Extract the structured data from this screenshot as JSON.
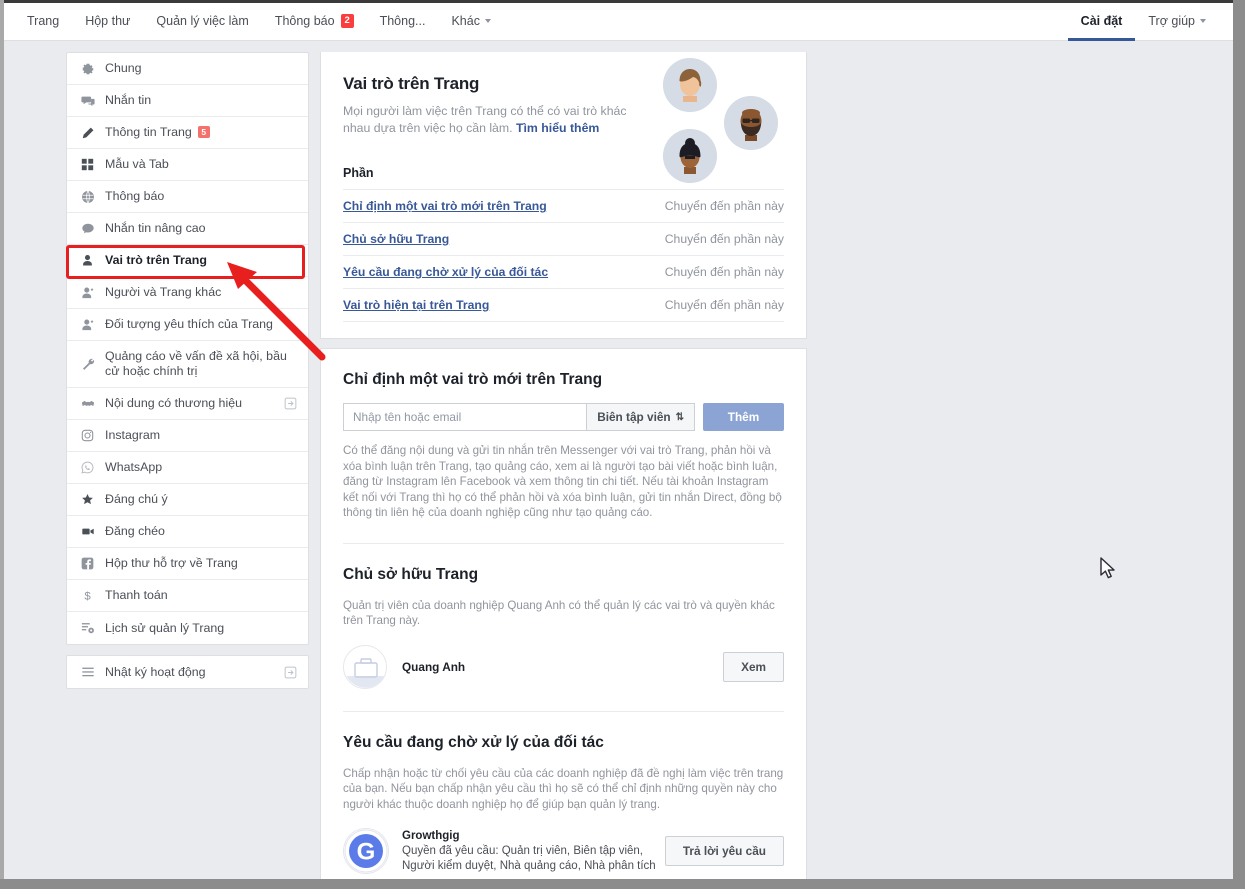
{
  "topnav": {
    "left_items": [
      {
        "label": "Trang",
        "badge": null,
        "caret": false
      },
      {
        "label": "Hộp thư",
        "badge": null,
        "caret": false
      },
      {
        "label": "Quản lý việc làm",
        "badge": null,
        "caret": false
      },
      {
        "label": "Thông báo",
        "badge": "2",
        "caret": false
      },
      {
        "label": "Thông...",
        "badge": null,
        "caret": false
      },
      {
        "label": "Khác",
        "badge": null,
        "caret": true
      }
    ],
    "right_items": [
      {
        "label": "Cài đặt",
        "active": true,
        "caret": false
      },
      {
        "label": "Trợ giúp",
        "active": false,
        "caret": true
      }
    ]
  },
  "sidebar": {
    "group1": [
      {
        "label": "Chung",
        "icon": "gear-icon",
        "badge": null,
        "external": false,
        "selected": false
      },
      {
        "label": "Nhắn tin",
        "icon": "messaging-icon",
        "badge": null,
        "external": false,
        "selected": false
      },
      {
        "label": "Thông tin Trang",
        "icon": "pencil-icon",
        "badge": "5",
        "external": false,
        "selected": false
      },
      {
        "label": "Mẫu và Tab",
        "icon": "grid-icon",
        "badge": null,
        "external": false,
        "selected": false
      },
      {
        "label": "Thông báo",
        "icon": "globe-icon",
        "badge": null,
        "external": false,
        "selected": false
      },
      {
        "label": "Nhắn tin nâng cao",
        "icon": "chat-bubble-icon",
        "badge": null,
        "external": false,
        "selected": false
      },
      {
        "label": "Vai trò trên Trang",
        "icon": "person-icon",
        "badge": null,
        "external": false,
        "selected": true
      },
      {
        "label": "Người và Trang khác",
        "icon": "person-star-icon",
        "badge": null,
        "external": false,
        "selected": false
      },
      {
        "label": "Đối tượng yêu thích của Trang",
        "icon": "person-star-icon",
        "badge": null,
        "external": false,
        "selected": false
      },
      {
        "label": "Quảng cáo về vấn đề xã hội, bầu cử hoặc chính trị",
        "icon": "wrench-icon",
        "badge": null,
        "external": false,
        "selected": false
      },
      {
        "label": "Nội dung có thương hiệu",
        "icon": "handshake-icon",
        "badge": null,
        "external": true,
        "selected": false
      },
      {
        "label": "Instagram",
        "icon": "instagram-icon",
        "badge": null,
        "external": false,
        "selected": false
      },
      {
        "label": "WhatsApp",
        "icon": "whatsapp-icon",
        "badge": null,
        "external": false,
        "selected": false
      },
      {
        "label": "Đáng chú ý",
        "icon": "star-icon",
        "badge": null,
        "external": false,
        "selected": false
      },
      {
        "label": "Đăng chéo",
        "icon": "video-icon",
        "badge": null,
        "external": false,
        "selected": false
      },
      {
        "label": "Hộp thư hỗ trợ về Trang",
        "icon": "facebook-icon",
        "badge": null,
        "external": false,
        "selected": false
      },
      {
        "label": "Thanh toán",
        "icon": "dollar-icon",
        "badge": null,
        "external": false,
        "selected": false
      },
      {
        "label": "Lịch sử quản lý Trang",
        "icon": "history-icon",
        "badge": null,
        "external": false,
        "selected": false
      }
    ],
    "group2": [
      {
        "label": "Nhật ký hoạt động",
        "icon": "list-icon",
        "badge": null,
        "external": true,
        "selected": false
      }
    ]
  },
  "hero": {
    "title": "Vai trò trên Trang",
    "description": "Mọi người làm việc trên Trang có thể có vai trò khác nhau dựa trên việc họ cần làm.",
    "learn_more": "Tìm hiểu thêm",
    "sections_label": "Phần",
    "jump_rows": [
      {
        "name": "Chỉ định một vai trò mới trên Trang",
        "action": "Chuyển đến phần này"
      },
      {
        "name": "Chủ sở hữu Trang",
        "action": "Chuyển đến phần này"
      },
      {
        "name": "Yêu cầu đang chờ xử lý của đối tác",
        "action": "Chuyển đến phần này"
      },
      {
        "name": "Vai trò hiện tại trên Trang",
        "action": "Chuyển đến phần này"
      }
    ]
  },
  "assign": {
    "title": "Chỉ định một vai trò mới trên Trang",
    "input_placeholder": "Nhập tên hoặc email",
    "input_value": "",
    "role_selected": "Biên tập viên",
    "add_label": "Thêm",
    "description": "Có thể đăng nội dung và gửi tin nhắn trên Messenger với vai trò Trang, phản hồi và xóa bình luận trên Trang, tạo quảng cáo, xem ai là người tạo bài viết hoặc bình luận, đăng từ Instagram lên Facebook và xem thông tin chi tiết. Nếu tài khoản Instagram kết nối với Trang thì họ có thể phản hồi và xóa bình luận, gửi tin nhắn Direct, đồng bộ thông tin liên hệ của doanh nghiệp cũng như tạo quảng cáo."
  },
  "owner": {
    "title": "Chủ sở hữu Trang",
    "description": "Quản trị viên của doanh nghiệp Quang Anh có thể quản lý các vai trò và quyền khác trên Trang này.",
    "owner_name": "Quang Anh",
    "view_label": "Xem"
  },
  "pending": {
    "title": "Yêu cầu đang chờ xử lý của đối tác",
    "description": "Chấp nhận hoặc từ chối yêu cầu của các doanh nghiệp đã đề nghị làm việc trên trang của bạn. Nếu bạn chấp nhận yêu cầu thì họ sẽ có thể chỉ định những quyền này cho người khác thuộc doanh nghiệp họ để giúp bạn quản lý trang.",
    "requester_name": "Growthgig",
    "requester_avatar_letter": "G",
    "requested_permissions": "Quyền đã yêu cầu: Quản trị viên, Biên tập viên, Người kiểm duyệt, Nhà quảng cáo, Nhà phân tích",
    "respond_label": "Trả lời yêu cầu"
  },
  "colors": {
    "link_blue": "#385898",
    "active_underline": "#365899",
    "badge_red": "#fa3e3e",
    "badge_salmon": "#f4726b",
    "annotation_red": "#e81f1f",
    "disabled_button": "#8ba4d4",
    "page_bg": "#e9ebee"
  }
}
